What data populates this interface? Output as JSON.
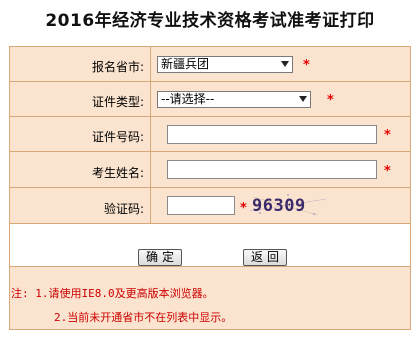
{
  "title": "2016年经济专业技术资格考试准考证打印",
  "form": {
    "province_label": "报名省市:",
    "province_value": "新疆兵团",
    "cert_type_label": "证件类型:",
    "cert_type_value": "--请选择--",
    "cert_number_label": "证件号码:",
    "cert_number_value": "",
    "name_label": "考生姓名:",
    "name_value": "",
    "captcha_label": "验证码:",
    "captcha_value": "",
    "captcha_image_text": "96309",
    "required_mark": "*"
  },
  "buttons": {
    "confirm": "确定",
    "back": "返回"
  },
  "notes": {
    "line1": "注: 1.请使用IE8.0及更高版本浏览器。",
    "line2": "2.当前未开通省市不在列表中显示。"
  },
  "colors": {
    "form_background": "#fbe4cf",
    "border": "#d9a878",
    "required": "#e00000",
    "note_text": "#cc0000"
  }
}
